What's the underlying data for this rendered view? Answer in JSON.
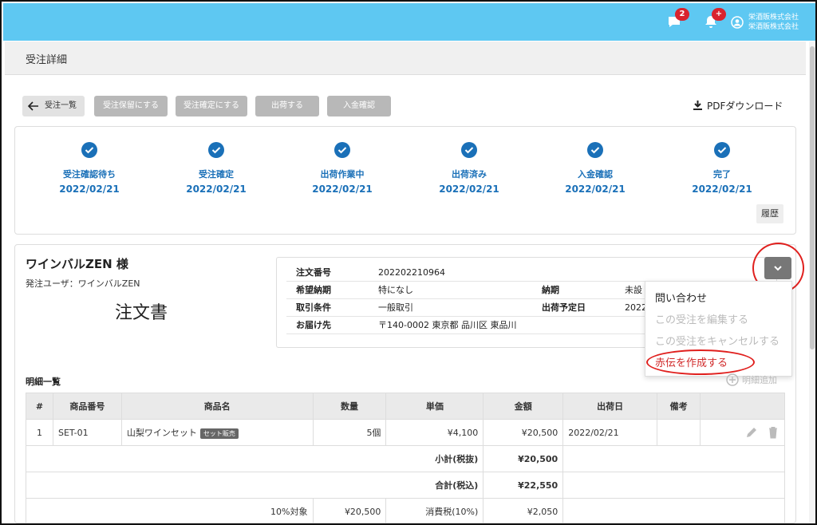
{
  "header": {
    "messages_badge": "2",
    "alerts_badge": "+",
    "company_line1": "栄酒販株式会社",
    "company_line2": "栄酒販株式会社"
  },
  "page_title": "受注詳細",
  "toolbar": {
    "back_label": "受注一覧",
    "hold_label": "受注保留にする",
    "confirm_label": "受注確定にする",
    "ship_label": "出荷する",
    "payment_label": "入金確認",
    "pdf_label": "PDFダウンロード"
  },
  "steps": [
    {
      "label": "受注確認待ち",
      "date": "2022/02/21"
    },
    {
      "label": "受注確定",
      "date": "2022/02/21"
    },
    {
      "label": "出荷作業中",
      "date": "2022/02/21"
    },
    {
      "label": "出荷済み",
      "date": "2022/02/21"
    },
    {
      "label": "入金確認",
      "date": "2022/02/21"
    },
    {
      "label": "完了",
      "date": "2022/02/21"
    }
  ],
  "history_label": "履歴",
  "customer": {
    "name": "ワインバルZEN 様",
    "user": "発注ユーザ：ワインバルZEN",
    "doc_title": "注文書"
  },
  "order_info": {
    "order_no_label": "注文番号",
    "order_no": "202202210964",
    "desired_label": "希望納期",
    "desired": "特になし",
    "deadline_label": "納期",
    "deadline": "未設",
    "terms_label": "取引条件",
    "terms": "一般取引",
    "ship_plan_label": "出荷予定日",
    "ship_plan": "2022",
    "dest_label": "お届け先",
    "dest": "〒140-0002 東京都 品川区 東品川"
  },
  "menu": {
    "inquiry": "問い合わせ",
    "edit": "この受注を編集する",
    "cancel": "この受注をキャンセルする",
    "red_slip": "赤伝を作成する"
  },
  "details": {
    "title": "明細一覧",
    "add_label": "明細追加",
    "columns": [
      "#",
      "商品番号",
      "商品名",
      "数量",
      "単価",
      "金額",
      "出荷日",
      "備考"
    ],
    "rows": [
      {
        "no": "1",
        "code": "SET-01",
        "name": "山梨ワインセット",
        "tag": "セット販売",
        "qty": "5個",
        "price": "¥4,100",
        "amount": "¥20,500",
        "ship_date": "2022/02/21",
        "note": ""
      }
    ],
    "subtotal_label": "小計(税抜)",
    "subtotal": "¥20,500",
    "total_label": "合計(税込)",
    "total": "¥22,550",
    "tax_target_label": "10%対象",
    "tax_target": "¥20,500",
    "tax_label": "消費税(10%)",
    "tax": "¥2,050"
  }
}
